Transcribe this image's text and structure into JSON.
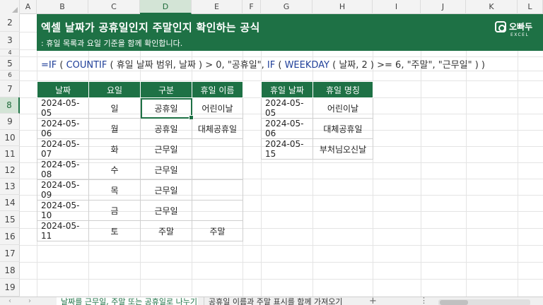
{
  "columns": [
    "A",
    "B",
    "C",
    "D",
    "E",
    "F",
    "G",
    "H",
    "I",
    "J",
    "K",
    "L"
  ],
  "selected_column": "D",
  "rows": [
    "2",
    "3",
    "4",
    "5",
    "6",
    "7",
    "8",
    "9",
    "10",
    "11",
    "12",
    "13",
    "14",
    "15",
    "16",
    "17",
    "18",
    "19"
  ],
  "selected_row": "8",
  "header": {
    "title": "엑셀 날짜가 공휴일인지 주말인지 확인하는 공식",
    "subtitle": ": 휴일 목록과 요일 기준을 함께 확인합니다.",
    "logo_text": "오빠두",
    "logo_sub": "EXCEL"
  },
  "formula": {
    "p1": "=IF",
    "p2": " ( ",
    "p3": "COUNTIF",
    "p4": " ( 휴일 날짜 범위, 날짜 ) > 0, \"공휴일\", ",
    "p5": "IF",
    "p6": " ( ",
    "p7": "WEEKDAY",
    "p8": " ( 날짜, 2 ) >= 6, \"주말\", \"근무일\" ) )"
  },
  "main_table": {
    "headers": [
      "날짜",
      "요일",
      "구분",
      "휴일 이름"
    ],
    "rows": [
      [
        "2024-05-05",
        "일",
        "공휴일",
        "어린이날"
      ],
      [
        "2024-05-06",
        "월",
        "공휴일",
        "대체공휴일"
      ],
      [
        "2024-05-07",
        "화",
        "근무일",
        ""
      ],
      [
        "2024-05-08",
        "수",
        "근무일",
        ""
      ],
      [
        "2024-05-09",
        "목",
        "근무일",
        ""
      ],
      [
        "2024-05-10",
        "금",
        "근무일",
        ""
      ],
      [
        "2024-05-11",
        "토",
        "주말",
        "주말"
      ]
    ]
  },
  "holiday_table": {
    "headers": [
      "휴일 날짜",
      "휴일 명칭"
    ],
    "rows": [
      [
        "2024-05-05",
        "어린이날"
      ],
      [
        "2024-05-06",
        "대체공휴일"
      ],
      [
        "2024-05-15",
        "부처님오신날"
      ]
    ]
  },
  "sheet_tabs": [
    {
      "label": "날짜를 근무일, 주말 또는 공휴일로 나누기",
      "active": true
    },
    {
      "label": "공휴일 이름과 주말 표시를 함께 가져오기",
      "active": false
    }
  ],
  "tab_nav": {
    "prev": "‹",
    "next": "›",
    "add": "+",
    "more": "⋮"
  },
  "colors": {
    "accent": "#1e7145",
    "formula": "#1f3f99"
  }
}
